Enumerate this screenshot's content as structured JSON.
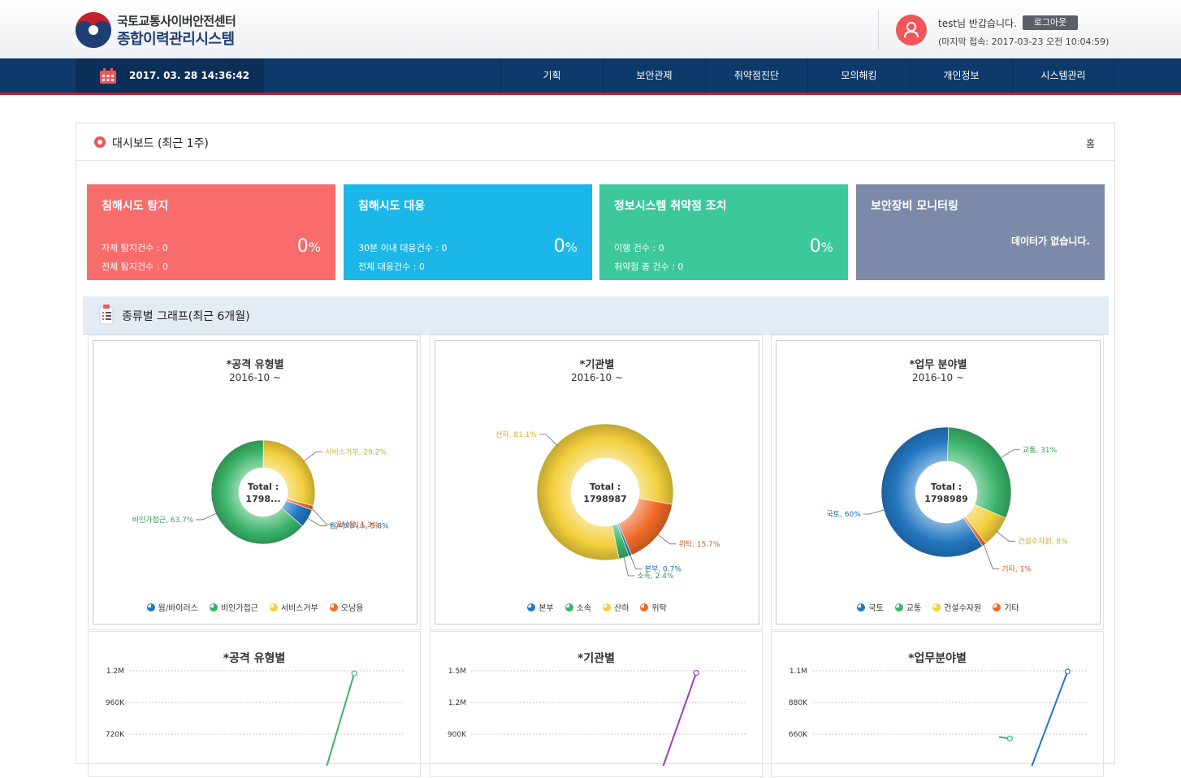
{
  "header": {
    "org_name": "국토교통사이버안전센터",
    "system_name": "종합이력관리시스템",
    "welcome": "test님 반갑습니다.",
    "logout_label": "로그아웃",
    "last_login": "(마지막 접속: 2017-03-23 오전 10:04:59)"
  },
  "nav": {
    "datetime": "2017. 03. 28 14:36:42",
    "items": [
      "기획",
      "보안관제",
      "취약점진단",
      "모의해킹",
      "개인정보",
      "시스템관리"
    ]
  },
  "dashboard": {
    "title": "대시보드 (최근 1주)",
    "home_label": "홈",
    "cards": [
      {
        "title": "침해시도 탐지",
        "line1": "자체 탐지건수 : 0",
        "line2": "전체 탐지건수 : 0",
        "percent": "0",
        "unit": "%",
        "color": "#f86c6b"
      },
      {
        "title": "침해시도 대응",
        "line1": "30분 이내 대응건수 : 0",
        "line2": "전체 대응건수 : 0",
        "percent": "0",
        "unit": "%",
        "color": "#1ab7e8"
      },
      {
        "title": "정보시스템 취약점 조치",
        "line1": "이행 건수 : 0",
        "line2": "취약점 총 건수 : 0",
        "percent": "0",
        "unit": "%",
        "color": "#3cc89b"
      },
      {
        "title": "보안장비 모니터링",
        "nodata": "데이터가 없습니다.",
        "color": "#7b8aa8"
      }
    ],
    "section_title": "종류별 그래프(최근 6개월)"
  },
  "colors": {
    "blue": "#2378c2",
    "green": "#3bb46a",
    "yellow": "#f2cf3c",
    "orange": "#f06a27"
  },
  "chart_data": [
    {
      "type": "pie",
      "title": "*공격 유형별",
      "subtitle": "2016-10 ~",
      "center_label": "Total :",
      "center_value": "1798...",
      "categories": [
        "웜/바이러스",
        "비인가접근",
        "서비스거부",
        "오남용"
      ],
      "values": [
        5.8,
        63.7,
        29.2,
        1.3
      ],
      "labels": [
        "웜/바이러스, 5.8%",
        "비인가접근, 63.7%",
        "서비스거부, 29.2%",
        "오남용, 1.3%"
      ],
      "colors": [
        "#2378c2",
        "#3bb46a",
        "#f2cf3c",
        "#f06a27"
      ]
    },
    {
      "type": "pie",
      "title": "*기관별",
      "subtitle": "2016-10 ~",
      "center_label": "Total :",
      "center_value": "1798987",
      "categories": [
        "본부",
        "소속",
        "산하",
        "위탁"
      ],
      "values": [
        0.7,
        2.4,
        81.1,
        15.7
      ],
      "labels": [
        "본부, 0.7%",
        "소속, 2.4%",
        "산하, 81.1%",
        "위탁, 15.7%"
      ],
      "colors": [
        "#2378c2",
        "#3bb46a",
        "#f2cf3c",
        "#f06a27"
      ]
    },
    {
      "type": "pie",
      "title": "*업무 분야별",
      "subtitle": "2016-10 ~",
      "center_label": "Total :",
      "center_value": "1798989",
      "categories": [
        "국토",
        "교통",
        "건설수자원",
        "기타"
      ],
      "values": [
        60,
        31,
        8,
        1
      ],
      "labels": [
        "국토, 60%",
        "교통, 31%",
        "건설수자원, 8%",
        "기타, 1%"
      ],
      "colors": [
        "#2378c2",
        "#3bb46a",
        "#f2cf3c",
        "#f06a27"
      ]
    },
    {
      "type": "line",
      "title": "*공격 유형별",
      "y_ticks": [
        "1.2M",
        "960K",
        "720K"
      ],
      "ylim": [
        480000,
        1200000
      ],
      "series": [
        {
          "color": "#3bb46a",
          "points": [
            [
              0.72,
              480000
            ],
            [
              0.82,
              1180000
            ]
          ]
        }
      ]
    },
    {
      "type": "line",
      "title": "*기관별",
      "y_ticks": [
        "1.5M",
        "1.2M",
        "900K"
      ],
      "ylim": [
        600000,
        1500000
      ],
      "series": [
        {
          "color": "#9b3fc0",
          "points": [
            [
              0.7,
              600000
            ],
            [
              0.82,
              1480000
            ]
          ]
        }
      ]
    },
    {
      "type": "line",
      "title": "*업무분야별",
      "y_ticks": [
        "1.1M",
        "880K",
        "660K"
      ],
      "ylim": [
        440000,
        1100000
      ],
      "series": [
        {
          "color": "#2378c2",
          "points": [
            [
              0.8,
              440000
            ],
            [
              0.93,
              1095000
            ]
          ]
        },
        {
          "color": "#3bb46a",
          "points": [
            [
              0.68,
              640000
            ],
            [
              0.72,
              630000
            ]
          ]
        }
      ]
    }
  ]
}
